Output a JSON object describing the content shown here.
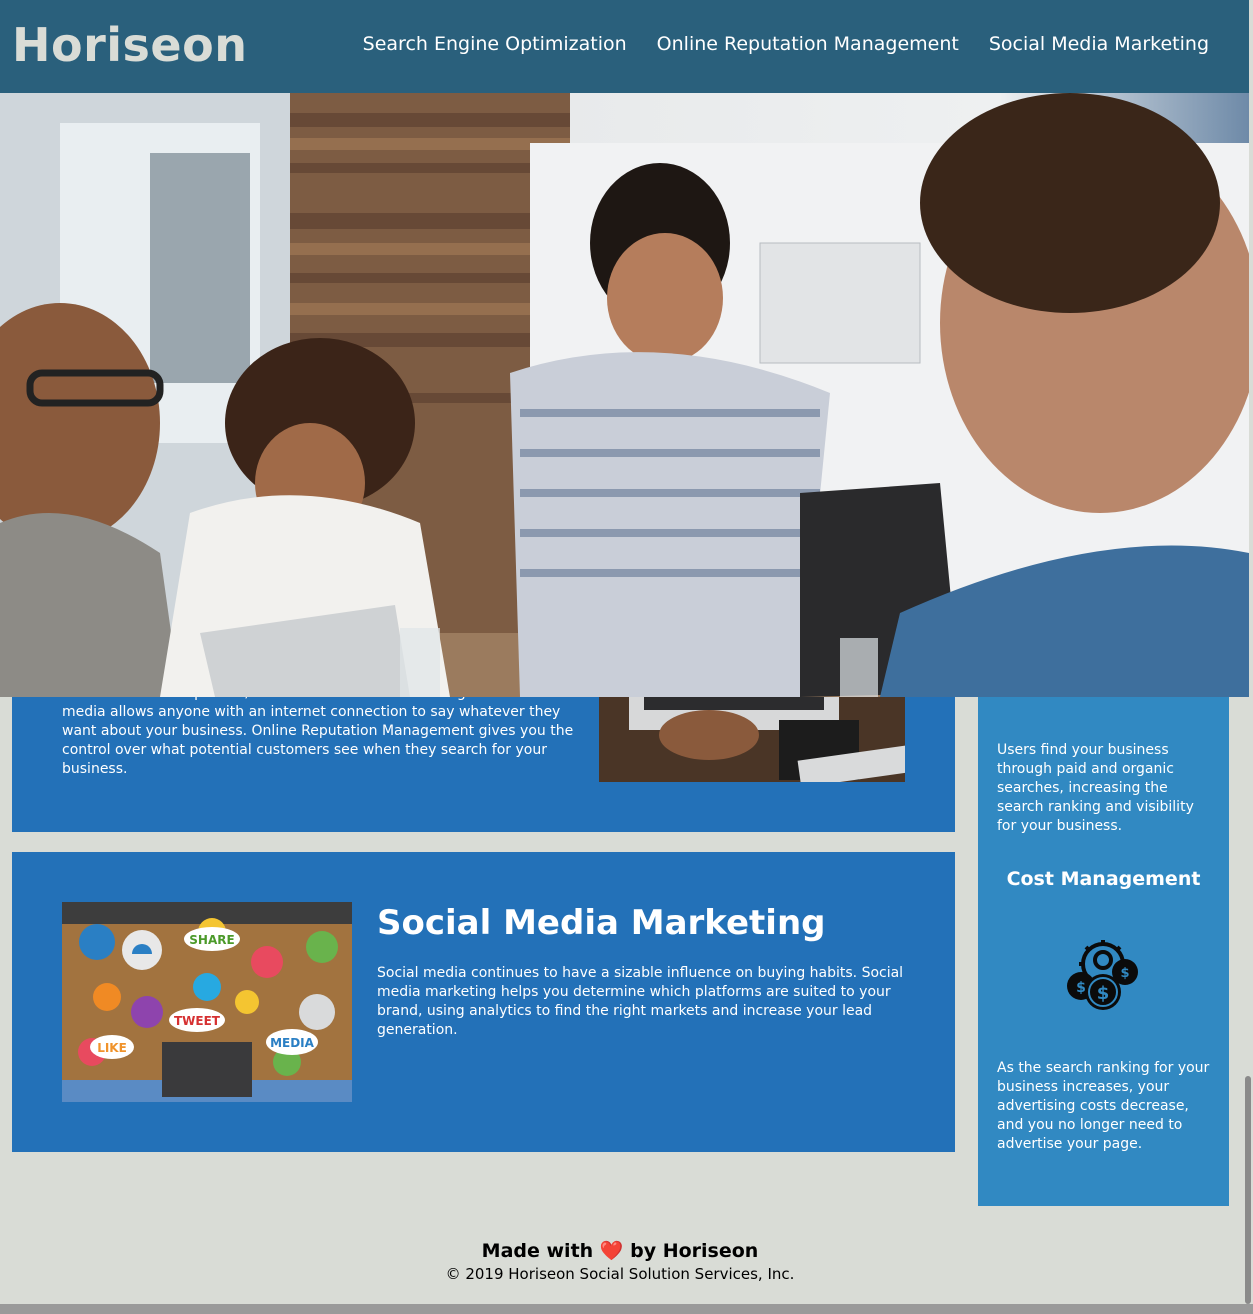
{
  "header": {
    "logo": "Horiseon",
    "nav": [
      {
        "label": "Search Engine Optimization"
      },
      {
        "label": "Online Reputation Management"
      },
      {
        "label": "Social Media Marketing"
      }
    ]
  },
  "orm": {
    "text": "The web is full of opinions, and some of these can be negative. Social media allows anyone with an internet connection to say whatever they want about your business. Online Reputation Management gives you the control over what potential customers see when they search for your business."
  },
  "smm": {
    "title": "Social Media Marketing",
    "text": "Social media continues to have a sizable influence on buying habits. Social media marketing helps you determine which platforms are suited to your brand, using analytics to find the right markets and increase your lead generation.",
    "image_words": {
      "share": "SHARE",
      "tweet": "TWEET",
      "like": "LIKE",
      "media": "MEDIA"
    }
  },
  "sidebar": {
    "lead_text": "Users find your business through paid and organic searches, increasing the search ranking and visibility for your business.",
    "cost_title": "Cost Management",
    "cost_icon": "cost-management-icon",
    "cost_text": "As the search ranking for your business increases, your advertising costs decrease, and you no longer need to advertise your page."
  },
  "footer": {
    "made_prefix": "Made with",
    "heart": "❤️",
    "made_suffix": "by Horiseon",
    "copyright": "© 2019 Horiseon Social Solution Services, Inc."
  },
  "colors": {
    "header_bg": "#2a607c",
    "page_bg": "#d9dcd6",
    "card_bg": "#2371b8",
    "sidebar_bg": "#3189c2",
    "logo": "#d9dcd6"
  }
}
